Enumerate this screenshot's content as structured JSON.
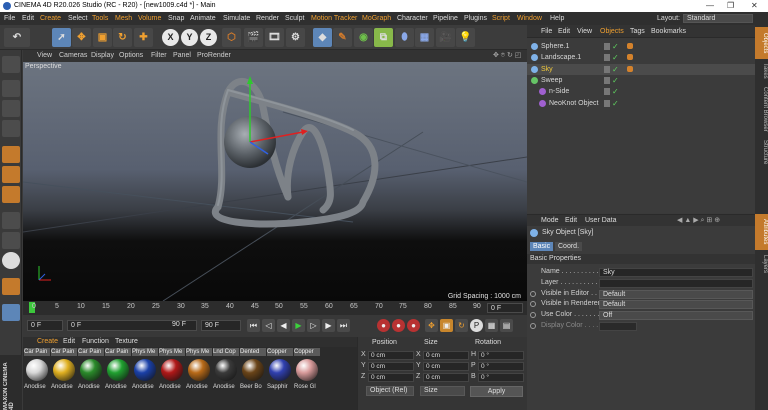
{
  "window": {
    "title": "CINEMA 4D R20.026 Studio (RC - R20) - [new1009.c4d *] - Main",
    "controls": [
      "—",
      "❐",
      "✕"
    ]
  },
  "menubar": {
    "items": [
      "File",
      "Edit",
      "Create",
      "Select",
      "Tools",
      "Mesh",
      "Volume",
      "Snap",
      "Animate",
      "Simulate",
      "Render",
      "Sculpt",
      "Motion Tracker",
      "MoGraph",
      "Character",
      "Pipeline",
      "Plugins",
      "Script",
      "Window",
      "Help"
    ],
    "layout_label": "Layout:",
    "layout_value": "Standard"
  },
  "toolbar": {
    "axis_buttons": [
      "X",
      "Y",
      "Z"
    ]
  },
  "viewport": {
    "menu": [
      "View",
      "Cameras",
      "Display",
      "Options",
      "Filter",
      "Panel",
      "ProRender"
    ],
    "label": "Perspective",
    "grid_spacing": "Grid Spacing : 1000 cm"
  },
  "timeline": {
    "ticks": [
      "0",
      "5",
      "10",
      "15",
      "20",
      "25",
      "30",
      "35",
      "40",
      "45",
      "50",
      "55",
      "60",
      "65",
      "70",
      "75",
      "80",
      "85",
      "90"
    ],
    "current_frame": "0 F",
    "start_frame": "0 F",
    "preview_start": "0 F",
    "preview_end": "90 F",
    "end_frame": "90 F"
  },
  "material_manager": {
    "menu": [
      "Create",
      "Edit",
      "Function",
      "Texture"
    ],
    "materials": [
      {
        "top": "Car Pain",
        "bottom": "Anodise",
        "color": "#d8d8d8"
      },
      {
        "top": "Car Pain",
        "bottom": "Anodise",
        "color": "#e0b020"
      },
      {
        "top": "Car Pain",
        "bottom": "Anodise",
        "color": "#2a8a2a"
      },
      {
        "top": "Car Pain",
        "bottom": "Anodise",
        "color": "#20a030"
      },
      {
        "top": "Phys Me",
        "bottom": "Anodise",
        "color": "#1a40a8"
      },
      {
        "top": "Phys Me",
        "bottom": "Anodise",
        "color": "#b01818"
      },
      {
        "top": "Phys Me",
        "bottom": "Anodise",
        "color": "#b86a18"
      },
      {
        "top": "Lnd Cop",
        "bottom": "Anodise",
        "color": "#3a3a3a"
      },
      {
        "top": "Dented",
        "bottom": "Beer Bo",
        "color": "#6a4418"
      },
      {
        "top": "Copper",
        "bottom": "Sapphir",
        "color": "#3040b0"
      },
      {
        "top": "Copper",
        "bottom": "Rose Gl",
        "color": "#d89a9a"
      }
    ]
  },
  "coordinates": {
    "headers": [
      "Position",
      "Size",
      "Rotation"
    ],
    "rows": [
      {
        "axis": "X",
        "position": "0 cm",
        "size_axis": "X",
        "size": "0 cm",
        "rot_axis": "H",
        "rotation": "0 °"
      },
      {
        "axis": "Y",
        "position": "0 cm",
        "size_axis": "Y",
        "size": "0 cm",
        "rot_axis": "P",
        "rotation": "0 °"
      },
      {
        "axis": "Z",
        "position": "0 cm",
        "size_axis": "Z",
        "size": "0 cm",
        "rot_axis": "B",
        "rotation": "0 °"
      }
    ],
    "mode_select": "Object (Rel)",
    "size_select": "Size",
    "apply_label": "Apply"
  },
  "object_manager": {
    "menu": [
      "File",
      "Edit",
      "View",
      "Objects",
      "Tags",
      "Bookmarks"
    ],
    "active_menu": "Objects",
    "objects": [
      {
        "name": "Sphere.1",
        "indent": 0,
        "icon_color": "#7fb2e8",
        "has_tag": true,
        "selected": false,
        "highlight": false
      },
      {
        "name": "Landscape.1",
        "indent": 0,
        "icon_color": "#7fb2e8",
        "has_tag": true,
        "selected": false,
        "highlight": false
      },
      {
        "name": "Sky",
        "indent": 0,
        "icon_color": "#7fb2e8",
        "has_tag": true,
        "selected": true,
        "highlight": true
      },
      {
        "name": "Sweep",
        "indent": 0,
        "icon_color": "#66c466",
        "has_tag": false,
        "selected": false,
        "highlight": false
      },
      {
        "name": "n-Side",
        "indent": 1,
        "icon_color": "#a060d0",
        "has_tag": false,
        "selected": false,
        "highlight": false
      },
      {
        "name": "NeoKnot Object",
        "indent": 1,
        "icon_color": "#a060d0",
        "has_tag": false,
        "selected": false,
        "highlight": false
      }
    ]
  },
  "attributes_manager": {
    "menu": [
      "Mode",
      "Edit",
      "User Data"
    ],
    "object_title": "Sky Object [Sky]",
    "tabs": [
      "Basic",
      "Coord."
    ],
    "section": "Basic Properties",
    "fields": [
      {
        "label": "Name . . . . . . . . . . . .",
        "value": "Sky",
        "kind": "text",
        "dim": false
      },
      {
        "label": "Layer . . . . . . . . . . . .",
        "value": "",
        "kind": "text",
        "dim": false
      },
      {
        "label": "Visible in Editor . .",
        "value": "Default",
        "kind": "select",
        "dim": false
      },
      {
        "label": "Visible in Renderer",
        "value": "Default",
        "kind": "select",
        "dim": false
      },
      {
        "label": "Use Color . . . . . . . .",
        "value": "Off",
        "kind": "select",
        "dim": false
      },
      {
        "label": "Display Color . . . . .",
        "value": "",
        "kind": "color",
        "dim": true
      }
    ]
  },
  "right_tabs": [
    "Objects",
    "Takes",
    "Content Browser",
    "Structure",
    "Attributes",
    "Layers"
  ],
  "brand": "MAXON CINEMA 4D"
}
